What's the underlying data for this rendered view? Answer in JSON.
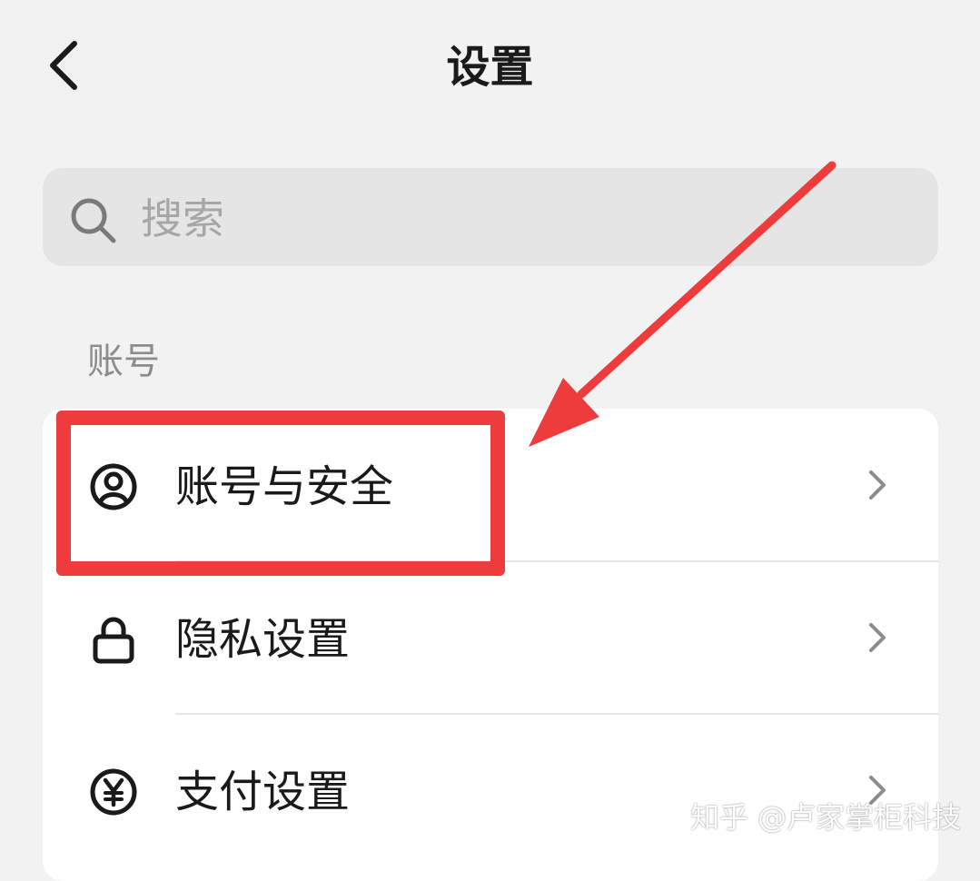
{
  "header": {
    "back_icon": "chevron-left-icon",
    "title": "设置"
  },
  "search": {
    "icon": "search-icon",
    "placeholder": "搜索"
  },
  "section": {
    "label": "账号"
  },
  "settings_items": [
    {
      "label": "账号与安全",
      "icon": "user-circle-icon",
      "highlighted": true
    },
    {
      "label": "隐私设置",
      "icon": "lock-icon",
      "highlighted": false
    },
    {
      "label": "支付设置",
      "icon": "yuan-circle-icon",
      "highlighted": false
    }
  ],
  "annotation": {
    "color": "#ee3b3b",
    "type": "red box and arrow"
  },
  "watermark": "知乎 @卢家掌柜科技"
}
